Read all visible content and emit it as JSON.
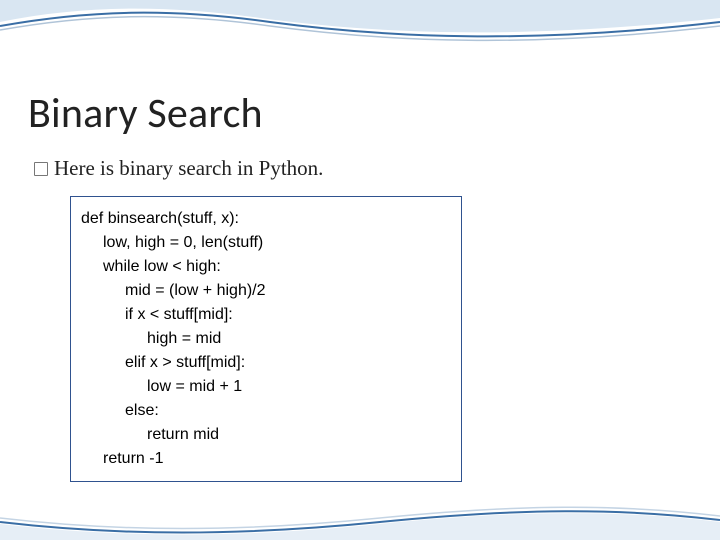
{
  "slide": {
    "title": "Binary Search",
    "subtitle": "Here is binary search in Python."
  },
  "code": {
    "l0": "def binsearch(stuff, x):",
    "l1": "low, high = 0, len(stuff)",
    "l2": "while low < high:",
    "l3": "mid = (low + high)/2",
    "l4": "if x < stuff[mid]:",
    "l5": "high = mid",
    "l6": "elif x > stuff[mid]:",
    "l7": "low = mid + 1",
    "l8": "else:",
    "l9": "return mid",
    "l10": "return -1"
  }
}
